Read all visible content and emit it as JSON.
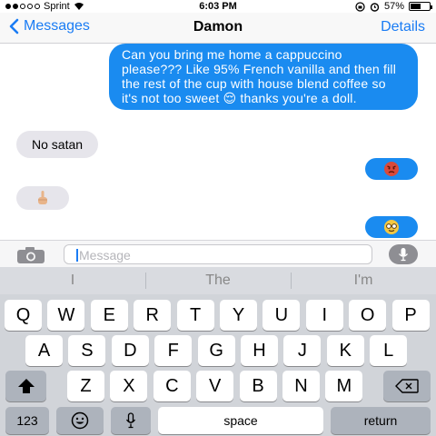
{
  "status_bar": {
    "carrier": "Sprint",
    "time": "6:03 PM",
    "battery": "57%",
    "battery_level": 0.57
  },
  "nav": {
    "back_label": "Messages",
    "title": "Damon",
    "details_label": "Details"
  },
  "messages": [
    {
      "direction": "outgoing",
      "text": "Can you bring me home a cappuccino please??? Like 95% French vanilla and then fill the rest of the cup with house blend coffee so it's not too sweet 😌 thanks you're a doll."
    },
    {
      "direction": "incoming",
      "text": "No satan"
    },
    {
      "direction": "outgoing",
      "emoji": "angry-face"
    },
    {
      "direction": "incoming",
      "emoji": "middle-finger"
    },
    {
      "direction": "outgoing",
      "emoji": "nerd-face"
    }
  ],
  "input": {
    "placeholder": "Message"
  },
  "predictive": [
    "I",
    "The",
    "I'm"
  ],
  "keyboard": {
    "row1": [
      "Q",
      "W",
      "E",
      "R",
      "T",
      "Y",
      "U",
      "I",
      "O",
      "P"
    ],
    "row2": [
      "A",
      "S",
      "D",
      "F",
      "G",
      "H",
      "J",
      "K",
      "L"
    ],
    "row3": [
      "Z",
      "X",
      "C",
      "V",
      "B",
      "N",
      "M"
    ],
    "numbers_label": "123",
    "space_label": "space",
    "return_label": "return"
  },
  "colors": {
    "accent": "#1a7cf4",
    "outgoing_bubble": "#1a8bf0",
    "incoming_bubble": "#e6e5eb"
  }
}
